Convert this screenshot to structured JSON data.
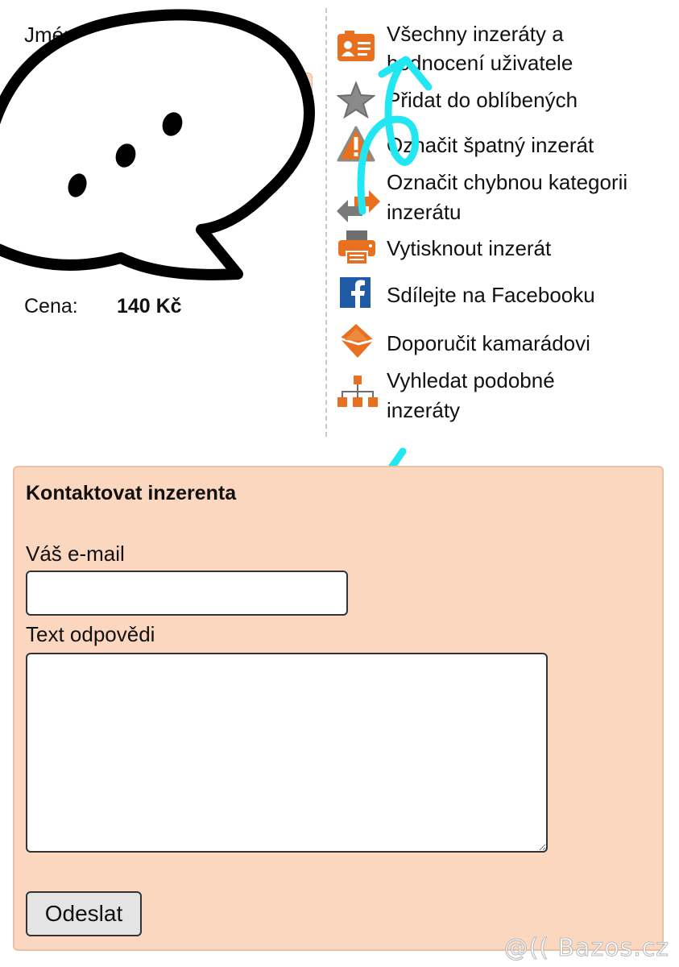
{
  "seller": {
    "name_label": "Jméno:",
    "price_label": "Cena:",
    "price_value": "140 Kč"
  },
  "menu": {
    "items": [
      {
        "label": "Všechny inzeráty a",
        "label2": "hodnocení uživatele",
        "icon": "user-card-icon"
      },
      {
        "label": "Přidat do oblíbených",
        "icon": "star-icon"
      },
      {
        "label": "Označit špatný inzerát",
        "icon": "warning-icon"
      },
      {
        "label": "Označit chybnou kategorii",
        "label2": "inzerátu",
        "icon": "arrows-icon"
      },
      {
        "label": "Vytisknout inzerát",
        "icon": "printer-icon"
      },
      {
        "label": "Sdílejte na Facebooku",
        "icon": "facebook-icon"
      },
      {
        "label": "Doporučit kamarádovi",
        "icon": "envelope-icon"
      },
      {
        "label": "Vyhledat podobné",
        "label2": "inzeráty",
        "icon": "sitemap-icon"
      }
    ]
  },
  "contact": {
    "title": "Kontaktovat inzerenta",
    "email_label": "Váš e-mail",
    "email_value": "",
    "text_label": "Text odpovědi",
    "text_value": "",
    "send_label": "Odeslat"
  },
  "watermark": "@(( Bazos.cz",
  "colors": {
    "accent_orange": "#e8701e",
    "form_background": "#fcd7c0",
    "facebook_blue": "#1e5aa5",
    "annotation_cyan": "#22e6f2"
  }
}
